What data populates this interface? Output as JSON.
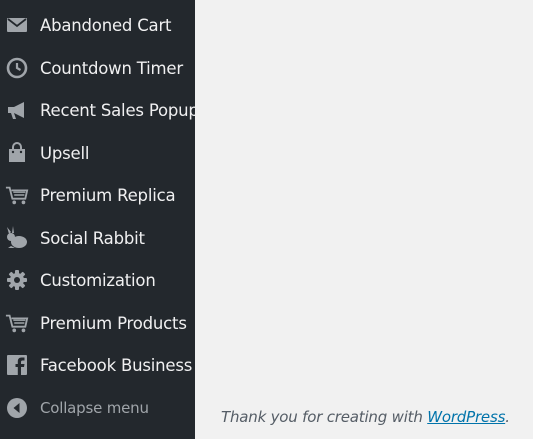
{
  "sidebar": {
    "items": [
      {
        "label": "Abandoned Cart",
        "icon": "envelope-icon"
      },
      {
        "label": "Countdown Timer",
        "icon": "clock-icon"
      },
      {
        "label": "Recent Sales Popup",
        "icon": "megaphone-icon"
      },
      {
        "label": "Upsell",
        "icon": "shopping-bag-icon"
      },
      {
        "label": "Premium Replica",
        "icon": "cart-icon"
      },
      {
        "label": "Social Rabbit",
        "icon": "rabbit-icon"
      },
      {
        "label": "Customization",
        "icon": "gear-icon"
      },
      {
        "label": "Premium Products",
        "icon": "cart-icon"
      },
      {
        "label": "Facebook Business",
        "icon": "facebook-icon"
      }
    ],
    "collapse": {
      "label": "Collapse menu",
      "icon": "collapse-arrow-icon"
    }
  },
  "footer": {
    "prefix": "Thank you for creating with ",
    "link": "WordPress",
    "suffix": "."
  },
  "colors": {
    "sidebar_bg": "#23282d",
    "icon": "#a0a5aa",
    "content_bg": "#f1f1f1",
    "link": "#0073aa"
  }
}
